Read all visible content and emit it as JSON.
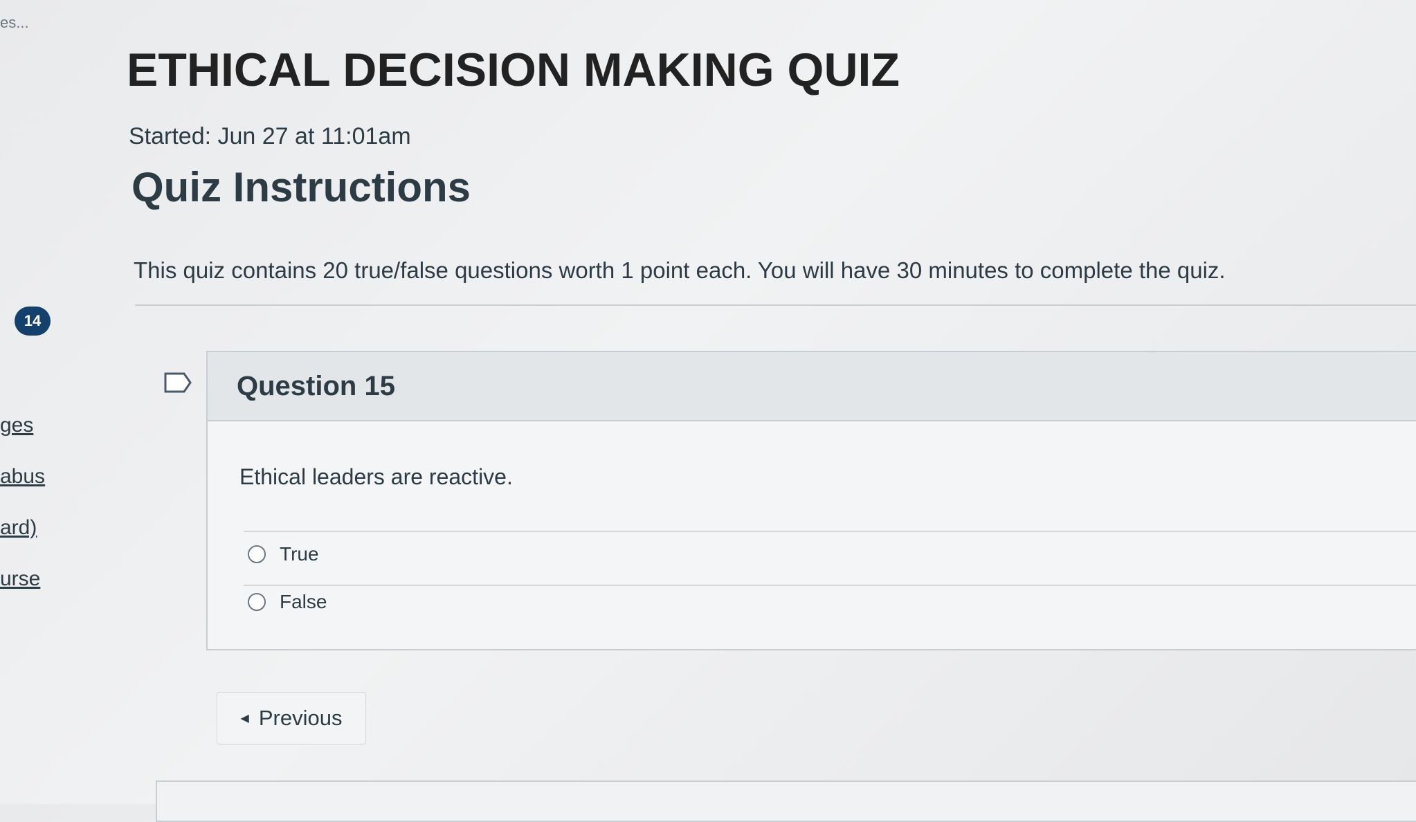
{
  "nav": {
    "top_fragment": "es...",
    "items": [
      "ges",
      "abus",
      "ard)",
      "urse"
    ],
    "badge": "14"
  },
  "quiz": {
    "title": "ETHICAL DECISION MAKING QUIZ",
    "started": "Started: Jun 27 at 11:01am",
    "instructions_heading": "Quiz Instructions",
    "instructions_text": "This quiz contains 20 true/false questions worth 1 point each. You will have 30 minutes to complete the quiz."
  },
  "question": {
    "label": "Question 15",
    "text": "Ethical leaders are reactive.",
    "answers": [
      "True",
      "False"
    ]
  },
  "navigation": {
    "previous_label": "Previous"
  },
  "icons": {
    "flag": "bookmark-flag-icon",
    "previous": "chevron-left-icon"
  },
  "colors": {
    "badge": "#14406c",
    "text": "#2d3b45",
    "border": "#c7cdd1"
  }
}
